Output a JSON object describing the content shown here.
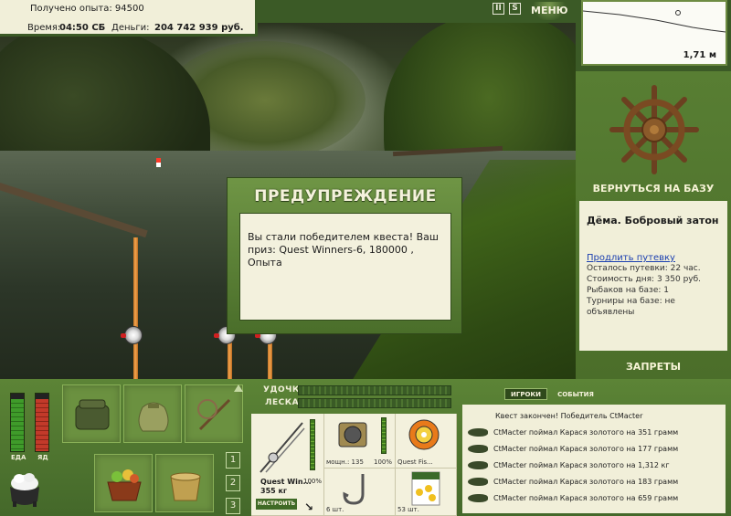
{
  "top_info": {
    "exp_label": "Получено опыта: 94500",
    "time_label": "Время:",
    "time_value": "04:50 СБ",
    "money_label": "Деньги:",
    "money_value": "204 742 939 руб."
  },
  "top_icons": {
    "pause_icon": "pause-icon",
    "settings_icon": "s-icon",
    "menu_label": "МЕНЮ"
  },
  "depth": {
    "value": "1,71 м"
  },
  "right_panel": {
    "return_label": "ВЕРНУТЬСЯ НА БАЗУ",
    "lake_name": "Дёма. Бобровый затон",
    "extend_link": "Продлить путевку",
    "stats": [
      "Осталось путевки: 22 час.",
      "Стоимость дня: 3 350 руб.",
      "Рыбаков на базе: 1",
      "Турниры на базе: не объявлены"
    ],
    "bans_label": "ЗАПРЕТЫ"
  },
  "dialog": {
    "title": "ПРЕДУПРЕЖДЕНИЕ",
    "message": "Вы стали победителем квеста! Ваш приз: Quest Winners-6, 180000 , Опыта"
  },
  "gauges": {
    "food_label": "ЕДА",
    "poison_label": "ЯД",
    "food_level": 0.9,
    "poison_level": 0.9
  },
  "inventory": {
    "pages": [
      "1",
      "2",
      "3"
    ]
  },
  "upgrade": {
    "rod_label": "УДОЧКА",
    "line_label": "ЛЕСКА"
  },
  "tackle": {
    "rod_name": "Quest Win...",
    "rod_weight": "355 кг",
    "rod_percent": "100%",
    "reel_caption": "мощн.: 135",
    "reel_percent": "100%",
    "line_caption": "Quest Fis...",
    "hook_caption": "6 шт.",
    "bait_caption": "53 шт.",
    "tune_label": "НАСТРОИТЬ"
  },
  "chat": {
    "tab_players": "ИГРОКИ",
    "tab_events": "СОБЫТИЯ",
    "header": "Квест закончен! Победитель CtMacter",
    "lines": [
      "CtMacter поймал Карася золотого на 351 грамм",
      "CtMacter поймал Карася золотого на 177 грамм",
      "CtMacter поймал Карася золотого на 1,312 кг",
      "CtMacter поймал Карася золотого на 183 грамм",
      "CtMacter поймал Карася золотого на 659 грамм"
    ]
  },
  "colors": {
    "panel_green": "#4b6e2a",
    "cream": "#f1efd9",
    "food": "#3f9b2a",
    "poison": "#c23a2a"
  }
}
